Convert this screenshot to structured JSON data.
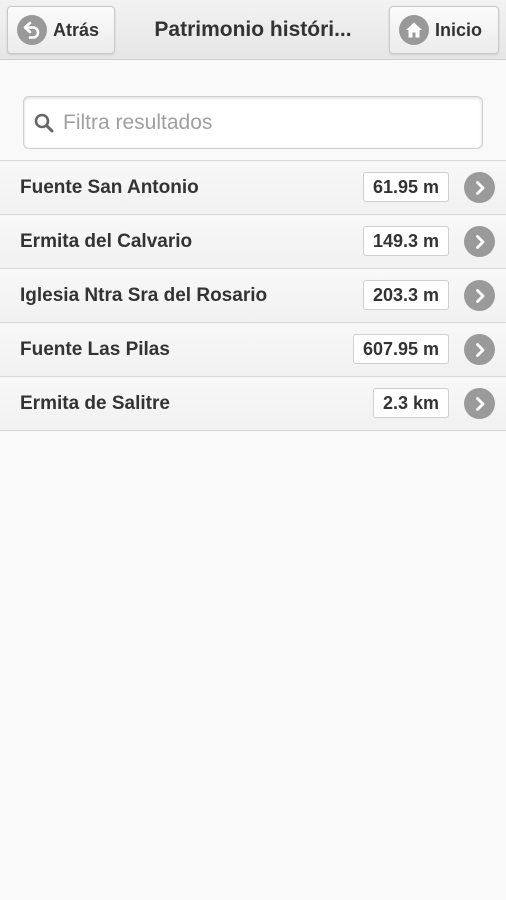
{
  "header": {
    "title": "Patrimonio históri...",
    "back_label": "Atrás",
    "home_label": "Inicio",
    "back_icon": "back-arrow-icon",
    "home_icon": "home-icon"
  },
  "search": {
    "placeholder": "Filtra resultados",
    "value": "",
    "icon": "search-icon"
  },
  "list": {
    "items": [
      {
        "name": "Fuente San Antonio",
        "distance": "61.95 m"
      },
      {
        "name": "Ermita del Calvario",
        "distance": "149.3 m"
      },
      {
        "name": "Iglesia Ntra Sra del Rosario",
        "distance": "203.3 m"
      },
      {
        "name": "Fuente Las Pilas",
        "distance": "607.95 m"
      },
      {
        "name": "Ermita de Salitre",
        "distance": "2.3 km"
      }
    ],
    "item_icon": "chevron-right-icon"
  }
}
